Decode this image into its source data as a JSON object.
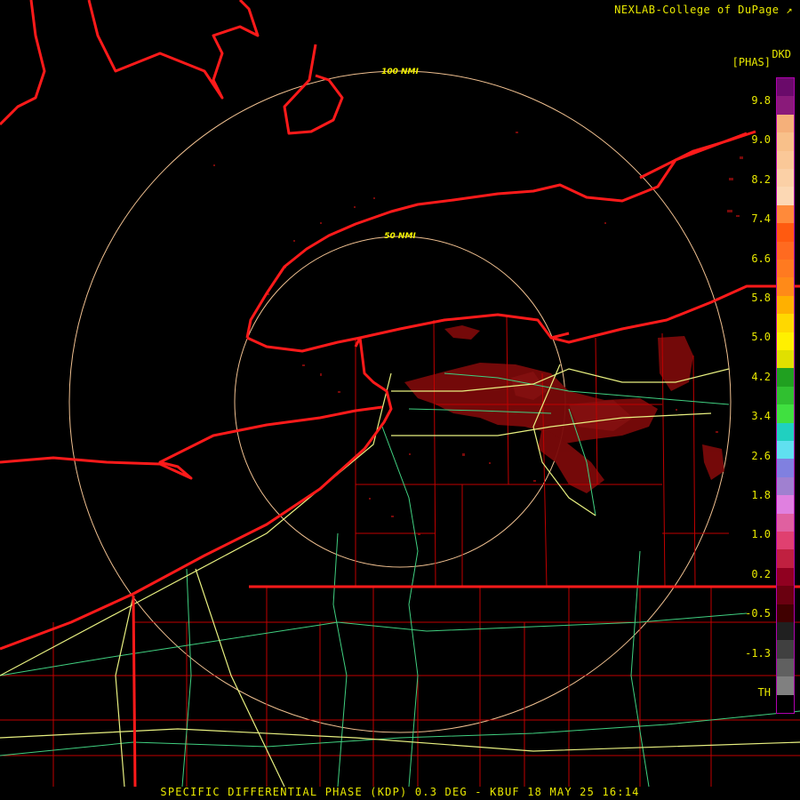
{
  "credit": "NEXLAB-College of DuPage",
  "footer": "SPECIFIC DIFFERENTIAL PHASE (KDP) 0.3 DEG - KBUF 18 MAY 25 16:14",
  "legend": {
    "code": "DKD",
    "units": "[PHAS]",
    "ticks": [
      "9.8",
      "9.0",
      "8.2",
      "7.4",
      "6.6",
      "5.8",
      "5.0",
      "4.2",
      "3.4",
      "2.6",
      "1.8",
      "1.0",
      "0.2",
      "-0.5",
      "-1.3",
      "TH"
    ],
    "colors": [
      "#6a0a6a",
      "#8a1a7a",
      "#f5b07a",
      "#f8c08a",
      "#fac898",
      "#fbd0a6",
      "#fcd8b4",
      "#ff8a3a",
      "#ff5a10",
      "#ff6a20",
      "#ff7a20",
      "#ff8a18",
      "#ffb000",
      "#ffd800",
      "#fff000",
      "#e0e000",
      "#20a020",
      "#30c030",
      "#40e040",
      "#20d0c0",
      "#60e0f0",
      "#8080e0",
      "#a080d0",
      "#e080e0",
      "#e060a0",
      "#e04070",
      "#c02040",
      "#900020",
      "#6a0010",
      "#400000",
      "#202020",
      "#404040",
      "#606060",
      "#808080",
      "#000000"
    ]
  },
  "range_rings": [
    "100 NMI",
    "50 NMI"
  ],
  "map_colors": {
    "boundary": "#ff1a1a",
    "county": "#c00000",
    "highway": "#e8f080",
    "road": "#40d080",
    "ring": "#f0c090",
    "echo": "#7a0a0a"
  }
}
